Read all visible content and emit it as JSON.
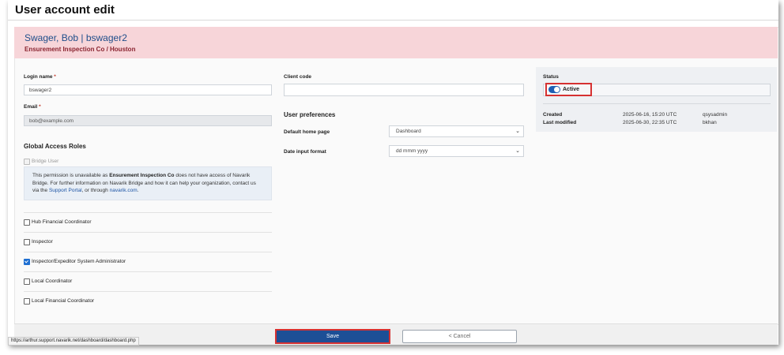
{
  "page": {
    "title": "User account edit"
  },
  "user": {
    "name_line": "Swager, Bob | bswager2",
    "org_line": "Ensurement Inspection Co / Houston"
  },
  "form": {
    "login_name_label": "Login name",
    "login_name_value": "bswager2",
    "email_label": "Email",
    "email_value": "bob@example.com",
    "required_mark": "*",
    "client_code_label": "Client code",
    "client_code_value": ""
  },
  "access_roles": {
    "heading": "Global Access Roles",
    "bridge_user_label": "Bridge User",
    "info": {
      "part1": "This permission is unavailable as ",
      "org": "Ensurement Inspection Co",
      "part2": " does not have access of Navarik Bridge. For further information on Navarik Bridge and how it can help your organization, contact us via the ",
      "link1": "Support Portal",
      "part3": ", or through ",
      "link2": "navarik.com",
      "part4": "."
    },
    "roles": [
      {
        "label": "Hub Financial Coordinator",
        "checked": false
      },
      {
        "label": "Inspector",
        "checked": false
      },
      {
        "label": "Inspector/Expeditor System Administrator",
        "checked": true
      },
      {
        "label": "Local Coordinator",
        "checked": false
      },
      {
        "label": "Local Financial Coordinator",
        "checked": false
      }
    ]
  },
  "preferences": {
    "heading": "User preferences",
    "home_page_label": "Default home page",
    "home_page_value": "Dashboard",
    "date_format_label": "Date input format",
    "date_format_value": "dd mmm yyyy"
  },
  "status": {
    "label": "Status",
    "toggle_label": "Active",
    "toggle_on": true,
    "created_label": "Created",
    "created_date": "2025-06-16, 15:20 UTC",
    "created_by": "qsysadmin",
    "modified_label": "Last modified",
    "modified_date": "2025-06-30, 22:35 UTC",
    "modified_by": "bkhan"
  },
  "actions": {
    "save_label": "Save",
    "cancel_label": "< Cancel"
  },
  "browser": {
    "status_url": "https://arthur.support.navarik.net/dashboard/dashboard.php"
  },
  "colors": {
    "primary": "#1d4f96",
    "header_bg": "#f7d5d9",
    "highlight": "#d63131",
    "org_text": "#8a2430"
  },
  "icons": {
    "dropdown": "chevron-down-icon",
    "toggle": "toggle-switch-icon",
    "checkbox": "checkbox-icon"
  }
}
